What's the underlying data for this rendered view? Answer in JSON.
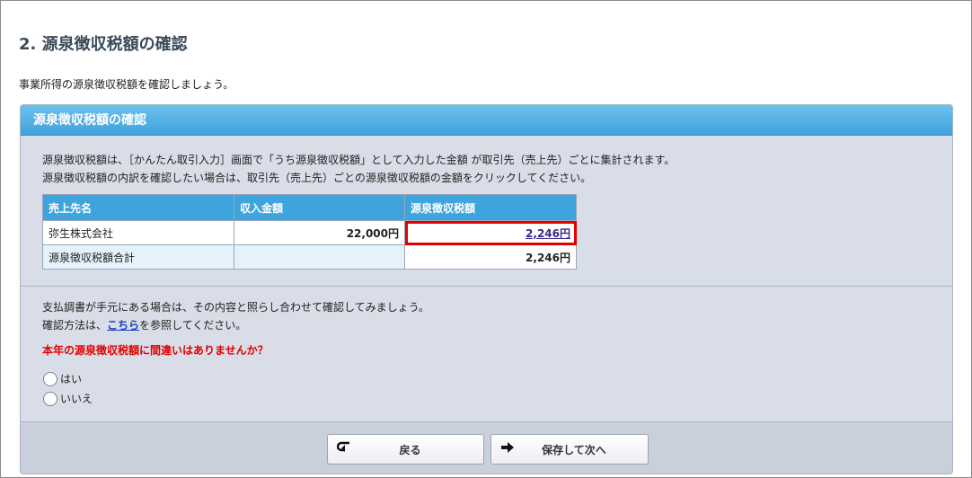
{
  "page": {
    "title": "2.  源泉徴収税額の確認",
    "intro": "事業所得の源泉徴収税額を確認しましょう。"
  },
  "panel": {
    "header": "源泉徴収税額の確認",
    "desc_line1": "源泉徴収税額は、［かんたん取引入力］画面で「うち源泉徴収税額」として入力した金額 が取引先（売上先）ごとに集計されます。",
    "desc_line2": "源泉徴収税額の内訳を確認したい場合は、取引先（売上先）ごとの源泉徴収税額の金額をクリックしてください。"
  },
  "table": {
    "headers": [
      "売上先名",
      "収入金額",
      "源泉徴収税額"
    ],
    "rows": [
      {
        "name": "弥生株式会社",
        "income": "22,000円",
        "tax": "2,246円"
      }
    ],
    "total": {
      "label": "源泉徴収税額合計",
      "income": "",
      "tax": "2,246円"
    }
  },
  "note": {
    "line1": "支払調書が手元にある場合は、その内容と照らし合わせて確認してみましょう。",
    "line2_prefix": "確認方法は、",
    "line2_link": "こちら",
    "line2_suffix": "を参照してください。"
  },
  "question": {
    "text": "本年の源泉徴収税額に間違いはありませんか？",
    "options": [
      "はい",
      "いいえ"
    ]
  },
  "buttons": {
    "back": "戻る",
    "next": "保存して次へ",
    "back_icon": "return-arrow-icon",
    "next_icon": "right-arrow-icon"
  },
  "colors": {
    "header_blue": "#3fa3db",
    "panel_bg": "#d9dde7",
    "question_red": "#e00000",
    "highlight_red": "#e00000"
  }
}
